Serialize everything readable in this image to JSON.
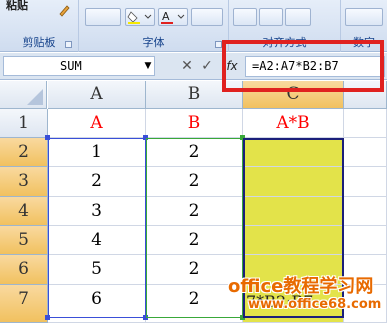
{
  "ribbon": {
    "paste_label": "粘贴",
    "groups": [
      {
        "label": "剪贴板"
      },
      {
        "label": "字体"
      },
      {
        "label": "对齐方式"
      },
      {
        "label": "数字"
      }
    ]
  },
  "formula_bar": {
    "name_box": "SUM",
    "cancel_icon": "✕",
    "enter_icon": "✓",
    "fx_icon": "fx",
    "formula": "=A2:A7*B2:B7"
  },
  "grid": {
    "columns": [
      "A",
      "B",
      "C"
    ],
    "rows": [
      "1",
      "2",
      "3",
      "4",
      "5",
      "6",
      "7"
    ],
    "header_row": [
      "A",
      "B",
      "A*B"
    ],
    "data": [
      [
        "1",
        "2",
        ""
      ],
      [
        "2",
        "2",
        ""
      ],
      [
        "3",
        "2",
        ""
      ],
      [
        "4",
        "2",
        ""
      ],
      [
        "5",
        "2",
        ""
      ],
      [
        "6",
        "2",
        ""
      ]
    ],
    "edit_echo": "=A2:A7*B2:B7",
    "edit_echo_visible": "7*B2:B7"
  },
  "watermark": {
    "line1": "office教程学习网",
    "line2": "www.office68.com"
  },
  "colors": {
    "accent_red": "#e0211f",
    "selection_yellow": "#e3e34a",
    "header_selected": "#f1c15f",
    "watermark_orange": "#e86a00"
  }
}
